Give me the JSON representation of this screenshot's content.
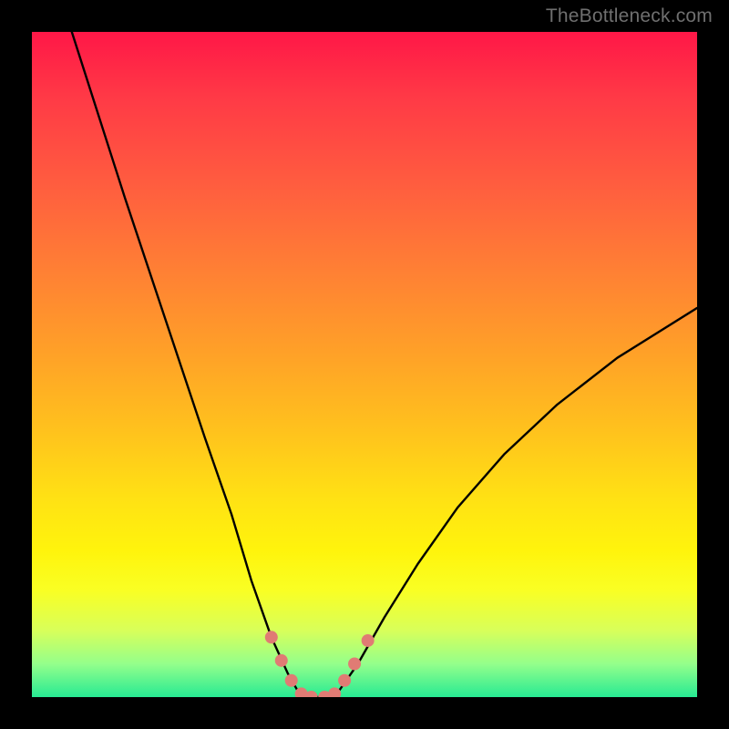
{
  "watermark": {
    "text": "TheBottleneck.com"
  },
  "chart_data": {
    "type": "line",
    "title": "",
    "xlabel": "",
    "ylabel": "",
    "xlim": [
      0,
      100
    ],
    "ylim": [
      0,
      100
    ],
    "grid": false,
    "legend": false,
    "gradient_stops": [
      {
        "pct": 0,
        "color": "#ff1747"
      },
      {
        "pct": 10,
        "color": "#ff3a46"
      },
      {
        "pct": 23,
        "color": "#ff5d3f"
      },
      {
        "pct": 36,
        "color": "#ff8034"
      },
      {
        "pct": 48,
        "color": "#ffa028"
      },
      {
        "pct": 60,
        "color": "#ffc21d"
      },
      {
        "pct": 70,
        "color": "#ffe114"
      },
      {
        "pct": 78,
        "color": "#fff40c"
      },
      {
        "pct": 84,
        "color": "#f9ff24"
      },
      {
        "pct": 90,
        "color": "#d8ff5a"
      },
      {
        "pct": 95,
        "color": "#94ff8b"
      },
      {
        "pct": 100,
        "color": "#27ea93"
      }
    ],
    "series": [
      {
        "name": "left-curve",
        "x": [
          6.0,
          10.0,
          14.0,
          18.0,
          22.0,
          26.0,
          30.0,
          33.0,
          36.0,
          38.5,
          40.5
        ],
        "y": [
          100.0,
          87.5,
          75.0,
          63.0,
          51.0,
          39.0,
          27.5,
          17.5,
          9.0,
          3.5,
          0.0
        ]
      },
      {
        "name": "flat-minimum",
        "x": [
          40.5,
          43.0,
          45.5
        ],
        "y": [
          0.0,
          0.0,
          0.0
        ]
      },
      {
        "name": "right-curve",
        "x": [
          45.5,
          49.0,
          53.0,
          58.0,
          64.0,
          71.0,
          79.0,
          88.0,
          100.0
        ],
        "y": [
          0.0,
          5.0,
          12.0,
          20.0,
          28.5,
          36.5,
          44.0,
          51.0,
          58.5
        ]
      }
    ],
    "highlight_points": {
      "name": "salmon-dots",
      "color": "#e07b74",
      "radius": 7,
      "points": [
        {
          "x": 36.0,
          "y": 9.0
        },
        {
          "x": 37.5,
          "y": 5.5
        },
        {
          "x": 39.0,
          "y": 2.5
        },
        {
          "x": 40.5,
          "y": 0.5
        },
        {
          "x": 42.0,
          "y": 0.0
        },
        {
          "x": 44.0,
          "y": 0.0
        },
        {
          "x": 45.5,
          "y": 0.5
        },
        {
          "x": 47.0,
          "y": 2.5
        },
        {
          "x": 48.5,
          "y": 5.0
        },
        {
          "x": 50.5,
          "y": 8.5
        }
      ]
    }
  }
}
